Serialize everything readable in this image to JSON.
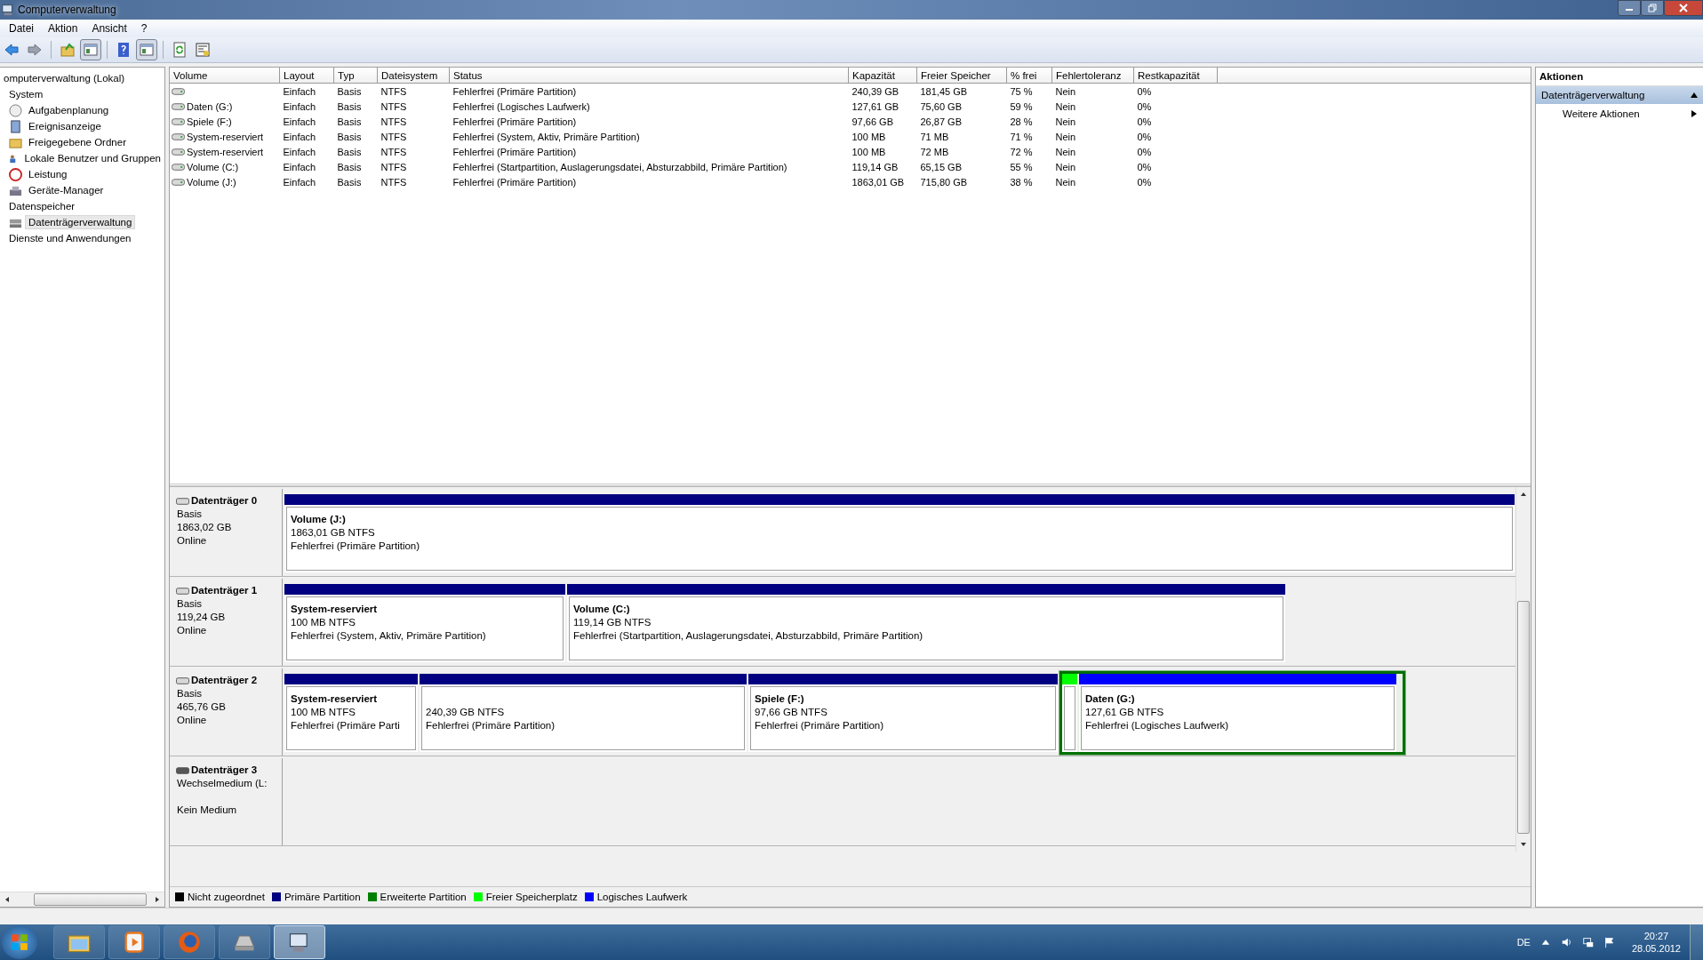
{
  "window": {
    "title": "Computerverwaltung"
  },
  "menu": [
    "Datei",
    "Aktion",
    "Ansicht",
    "?"
  ],
  "toolbar": [
    {
      "kind": "back"
    },
    {
      "kind": "forward"
    },
    {
      "kind": "up"
    },
    {
      "kind": "tree",
      "selected": true
    },
    {
      "kind": "help"
    },
    {
      "kind": "panel",
      "selected": true
    },
    {
      "kind": "refresh"
    },
    {
      "kind": "properties"
    }
  ],
  "tree": [
    {
      "label": "omputerverwaltung (Lokal)",
      "kind": "root",
      "selected": false,
      "children": [
        {
          "label": "System",
          "kind": "group",
          "selected": false,
          "children": [
            {
              "label": "Aufgabenplanung",
              "kind": "clock",
              "selected": false
            },
            {
              "label": "Ereignisanzeige",
              "kind": "log",
              "selected": false
            },
            {
              "label": "Freigegebene Ordner",
              "kind": "share",
              "selected": false
            },
            {
              "label": "Lokale Benutzer und Gruppen",
              "kind": "users",
              "selected": false
            },
            {
              "label": "Leistung",
              "kind": "perf",
              "selected": false
            },
            {
              "label": "Geräte-Manager",
              "kind": "device",
              "selected": false
            }
          ]
        },
        {
          "label": "Datenspeicher",
          "kind": "group",
          "selected": false,
          "children": [
            {
              "label": "Datenträgerverwaltung",
              "kind": "disk",
              "selected": true
            }
          ]
        },
        {
          "label": "Dienste und Anwendungen",
          "kind": "group",
          "selected": false
        }
      ]
    }
  ],
  "table": {
    "columns": [
      "Volume",
      "Layout",
      "Typ",
      "Dateisystem",
      "Status",
      "Kapazität",
      "Freier Speicher",
      "% frei",
      "Fehlertoleranz",
      "Restkapazität"
    ],
    "rows": [
      [
        "",
        "Einfach",
        "Basis",
        "NTFS",
        "Fehlerfrei (Primäre Partition)",
        "240,39 GB",
        "181,45 GB",
        "75 %",
        "Nein",
        "0%"
      ],
      [
        "Daten (G:)",
        "Einfach",
        "Basis",
        "NTFS",
        "Fehlerfrei (Logisches Laufwerk)",
        "127,61 GB",
        "75,60 GB",
        "59 %",
        "Nein",
        "0%"
      ],
      [
        "Spiele (F:)",
        "Einfach",
        "Basis",
        "NTFS",
        "Fehlerfrei (Primäre Partition)",
        "97,66 GB",
        "26,87 GB",
        "28 %",
        "Nein",
        "0%"
      ],
      [
        "System-reserviert",
        "Einfach",
        "Basis",
        "NTFS",
        "Fehlerfrei (System, Aktiv, Primäre Partition)",
        "100 MB",
        "71 MB",
        "71 %",
        "Nein",
        "0%"
      ],
      [
        "System-reserviert",
        "Einfach",
        "Basis",
        "NTFS",
        "Fehlerfrei (Primäre Partition)",
        "100 MB",
        "72 MB",
        "72 %",
        "Nein",
        "0%"
      ],
      [
        "Volume (C:)",
        "Einfach",
        "Basis",
        "NTFS",
        "Fehlerfrei (Startpartition, Auslagerungsdatei, Absturzabbild, Primäre Partition)",
        "119,14 GB",
        "65,15 GB",
        "55 %",
        "Nein",
        "0%"
      ],
      [
        "Volume (J:)",
        "Einfach",
        "Basis",
        "NTFS",
        "Fehlerfrei (Primäre Partition)",
        "1863,01 GB",
        "715,80 GB",
        "38 %",
        "Nein",
        "0%"
      ]
    ]
  },
  "disks": [
    {
      "name": "Datenträger 0",
      "kind": "fixed",
      "lines": [
        "Basis",
        "1863,02 GB",
        "Online"
      ],
      "partitions": [
        {
          "kind": "primary",
          "title": "Volume  (J:)",
          "size": "1863,01 GB NTFS",
          "status": "Fehlerfrei (Primäre Partition)"
        }
      ]
    },
    {
      "name": "Datenträger 1",
      "kind": "fixed",
      "lines": [
        "Basis",
        "119,24 GB",
        "Online"
      ],
      "partitions": [
        {
          "kind": "primary",
          "title": "System-reserviert",
          "size": "100 MB NTFS",
          "status": "Fehlerfrei (System, Aktiv, Primäre Partition)"
        },
        {
          "kind": "primary",
          "title": "Volume  (C:)",
          "size": "119,14 GB NTFS",
          "status": "Fehlerfrei (Startpartition, Auslagerungsdatei, Absturzabbild, Primäre Partition)"
        }
      ]
    },
    {
      "name": "Datenträger 2",
      "kind": "fixed",
      "lines": [
        "Basis",
        "465,76 GB",
        "Online"
      ],
      "partitions": [
        {
          "kind": "primary",
          "title": "System-reserviert",
          "size": "100 MB NTFS",
          "status": "Fehlerfrei (Primäre Parti"
        },
        {
          "kind": "primary",
          "size": "240,39 GB NTFS",
          "status": "Fehlerfrei (Primäre Partition)"
        },
        {
          "kind": "primary",
          "title": "Spiele  (F:)",
          "size": "97,66 GB NTFS",
          "status": "Fehlerfrei (Primäre Partition)"
        },
        {
          "kind": "extended",
          "selected": true,
          "children": [
            {
              "kind": "free"
            },
            {
              "kind": "logical",
              "title": "Daten  (G:)",
              "size": "127,61 GB NTFS",
              "status": "Fehlerfrei (Logisches Laufwerk)"
            }
          ]
        }
      ]
    },
    {
      "name": "Datenträger 3",
      "kind": "removable",
      "lines": [
        "Wechselmedium (L:"
      ],
      "media": "Kein Medium"
    }
  ],
  "legend": [
    {
      "label": "Nicht zugeordnet",
      "color": "#000000"
    },
    {
      "label": "Primäre Partition",
      "color": "#000080"
    },
    {
      "label": "Erweiterte Partition",
      "color": "#008000"
    },
    {
      "label": "Freier Speicherplatz",
      "color": "#00ff00"
    },
    {
      "label": "Logisches Laufwerk",
      "color": "#0000ff"
    }
  ],
  "actions": {
    "title": "Aktionen",
    "section": "Datenträgerverwaltung",
    "items": [
      "Weitere Aktionen"
    ]
  },
  "taskbar": {
    "apps": [
      {
        "kind": "explorer",
        "selected": false
      },
      {
        "kind": "media",
        "selected": false
      },
      {
        "kind": "browser",
        "selected": false
      },
      {
        "kind": "drive",
        "selected": false
      },
      {
        "kind": "mmc",
        "selected": true
      }
    ],
    "language": "DE",
    "time": "20:27",
    "date": "28.05.2012"
  }
}
